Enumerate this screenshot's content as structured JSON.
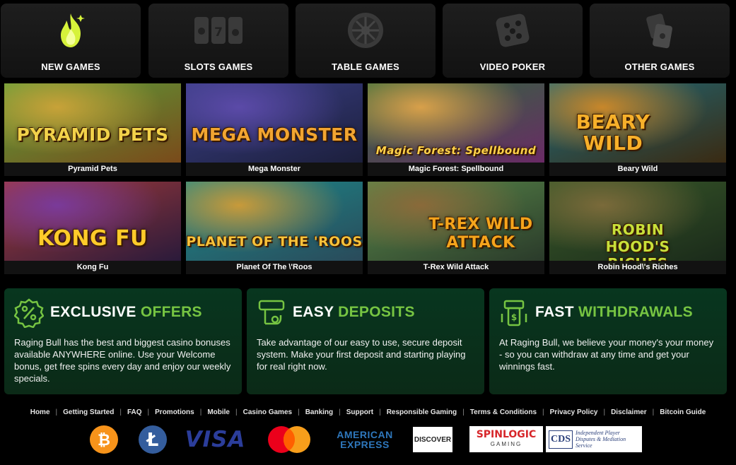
{
  "categories": [
    {
      "label": "NEW GAMES",
      "icon": "flame-icon"
    },
    {
      "label": "SLOTS GAMES",
      "icon": "slot-reels-icon"
    },
    {
      "label": "TABLE GAMES",
      "icon": "roulette-wheel-icon"
    },
    {
      "label": "VIDEO POKER",
      "icon": "dice-icon"
    },
    {
      "label": "OTHER GAMES",
      "icon": "cards-icon"
    }
  ],
  "games": [
    {
      "name": "Pyramid Pets",
      "logo": "PYRAMID PETS",
      "colors": [
        "#5aa03a",
        "#c8a238",
        "#7a4a1a"
      ],
      "logo_color": "#f2d24a"
    },
    {
      "name": "Mega Monster",
      "logo": "MEGA MONSTER",
      "colors": [
        "#3a3f86",
        "#5b4aa8",
        "#1c1f3c"
      ],
      "logo_color": "#f2a531"
    },
    {
      "name": "Magic Forest: Spellbound",
      "logo": "Magic Forest: Spellbound",
      "colors": [
        "#2c6b3a",
        "#d8a04a",
        "#6a2a66"
      ],
      "logo_color": "#ffd24a"
    },
    {
      "name": "Beary Wild",
      "logo": "BEARY WILD",
      "colors": [
        "#1f6b7a",
        "#c8872a",
        "#3a2a12"
      ],
      "logo_color": "#f7b02a"
    },
    {
      "name": "Kong Fu",
      "logo": "KONG FU",
      "colors": [
        "#a33a3a",
        "#7a3a9a",
        "#2a1a3a"
      ],
      "logo_color": "#ffcb2a"
    },
    {
      "name": "Planet Of The \\'Roos",
      "logo": "PLANET OF THE 'ROOS",
      "colors": [
        "#1b8a8a",
        "#c89a3a",
        "#2a4a5a"
      ],
      "logo_color": "#f7c23a"
    },
    {
      "name": "T-Rex Wild Attack",
      "logo": "T-REX WILD ATTACK",
      "colors": [
        "#5a8a4a",
        "#8a6a3a",
        "#2a3a2a"
      ],
      "logo_color": "#f5a41c"
    },
    {
      "name": "Robin Hood\\'s Riches",
      "logo": "ROBIN HOOD'S RICHES",
      "colors": [
        "#3a5a2a",
        "#7a6a3a",
        "#1a2a1a"
      ],
      "logo_color": "#c8e03a"
    }
  ],
  "features": [
    {
      "title_plain": "EXCLUSIVE",
      "title_accent": "OFFERS",
      "icon": "percent-badge-icon",
      "text": "Raging Bull has the best and biggest casino bonuses available ANYWHERE online. Use your Welcome bonus, get free spins every day and enjoy our weekly specials."
    },
    {
      "title_plain": "EASY",
      "title_accent": "DEPOSITS",
      "icon": "deposit-hand-icon",
      "text": "Take advantage of our easy to use, secure deposit system. Make your first deposit and starting playing for real right now."
    },
    {
      "title_plain": "FAST",
      "title_accent": "WITHDRAWALS",
      "icon": "atm-cash-icon",
      "text": "At Raging Bull, we believe your money's your money - so you can withdraw at any time and get your winnings fast."
    }
  ],
  "footer_links": [
    "Home",
    "Getting Started",
    "FAQ",
    "Promotions",
    "Mobile",
    "Casino Games",
    "Banking",
    "Support",
    "Responsible Gaming",
    "Terms & Conditions",
    "Privacy Policy",
    "Disclaimer",
    "Bitcoin Guide"
  ],
  "payments": {
    "bitcoin": "₿",
    "litecoin": "Ł",
    "visa": "VISA",
    "amex_line1": "AMERICAN",
    "amex_line2": "EXPRESS",
    "discover": "DISCOVER",
    "spinlogic_main": "SPINLOGIC",
    "spinlogic_sub": "GAMING",
    "cds_main": "CDS",
    "cds_text": "Independent Player Disputes & Mediation Service"
  },
  "colors": {
    "accent": "#76c442",
    "card_bg": "#0a3a1f"
  }
}
